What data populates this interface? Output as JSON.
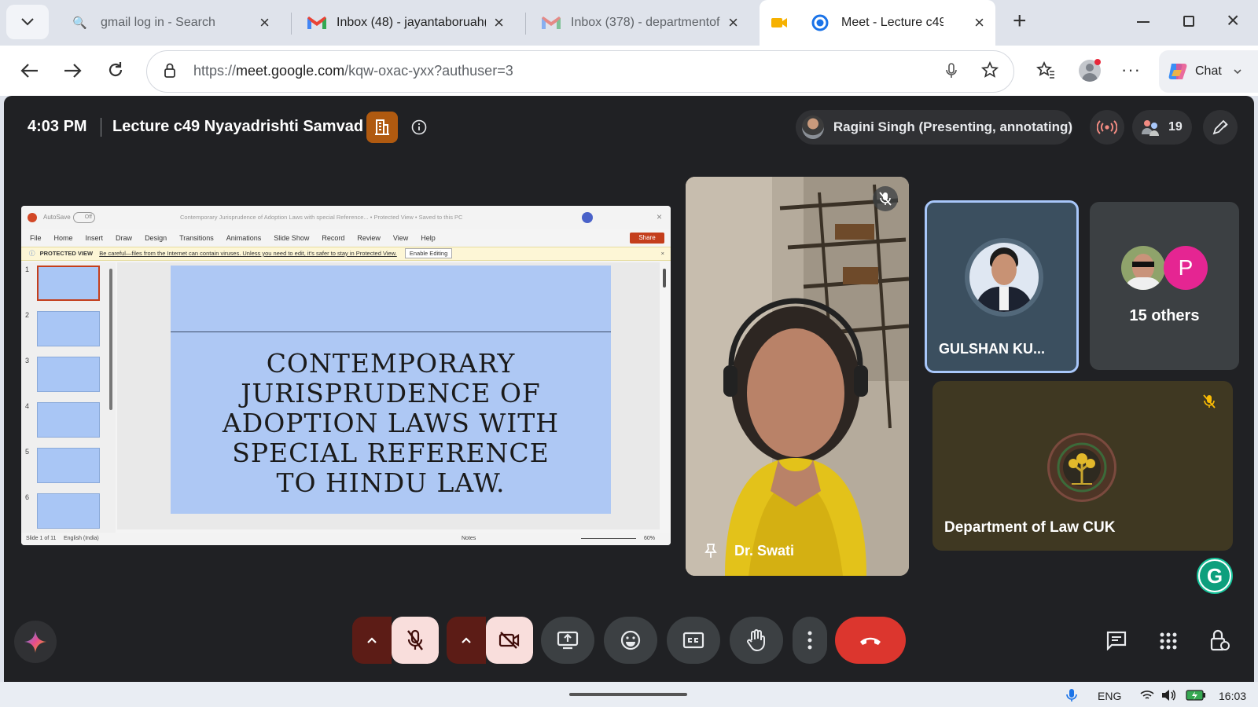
{
  "browser": {
    "tabs": [
      {
        "title": "gmail log in - Search",
        "icon": "search-icon"
      },
      {
        "title": "Inbox (48) - jayantaboruah(",
        "icon": "gmail-icon"
      },
      {
        "title": "Inbox (378) - departmentof",
        "icon": "gmail-icon"
      },
      {
        "title": "Meet - Lecture c49",
        "icon": "meet-icon",
        "active": true
      }
    ],
    "url_prefix": "https://",
    "url_host": "meet.google.com",
    "url_path": "/kqw-oxac-yxx?authuser=3",
    "chat_label": "Chat"
  },
  "meet": {
    "time": "4:03 PM",
    "title": "Lecture c49 Nyayadrishti Samvad",
    "presenter": "Ragini Singh (Presenting, annotating)",
    "participants_count": "19",
    "participants": [
      {
        "name": "Dr. Swati",
        "muted": true
      },
      {
        "name": "GULSHAN KU...",
        "speaking": true
      },
      {
        "name": "15 others",
        "avatar_letter": "P"
      },
      {
        "name": "Department of Law CUK",
        "muted": true
      }
    ]
  },
  "ppt": {
    "autosave": "AutoSave",
    "autosave_state": "Off",
    "doc_title": "Contemporary Jurisprudence of Adoption Laws with special Reference... • Protected View • Saved to this PC",
    "menu": [
      "File",
      "Home",
      "Insert",
      "Draw",
      "Design",
      "Transitions",
      "Animations",
      "Slide Show",
      "Record",
      "Review",
      "View",
      "Help"
    ],
    "share": "Share",
    "protected_label": "PROTECTED VIEW",
    "protected_msg": "Be careful—files from the Internet can contain viruses. Unless you need to edit, it's safer to stay in Protected View.",
    "enable_editing": "Enable Editing",
    "slide_text": "CONTEMPORARY JURISPRUDENCE OF ADOPTION LAWS WITH SPECIAL REFERENCE TO HINDU LAW.",
    "slide_numbers": [
      "1",
      "2",
      "3",
      "4",
      "5",
      "6"
    ],
    "status_left": "Slide 1 of 11",
    "language": "English (India)",
    "notes": "Notes",
    "zoom": "60%"
  },
  "taskbar": {
    "lang": "ENG",
    "time": "16:03"
  }
}
